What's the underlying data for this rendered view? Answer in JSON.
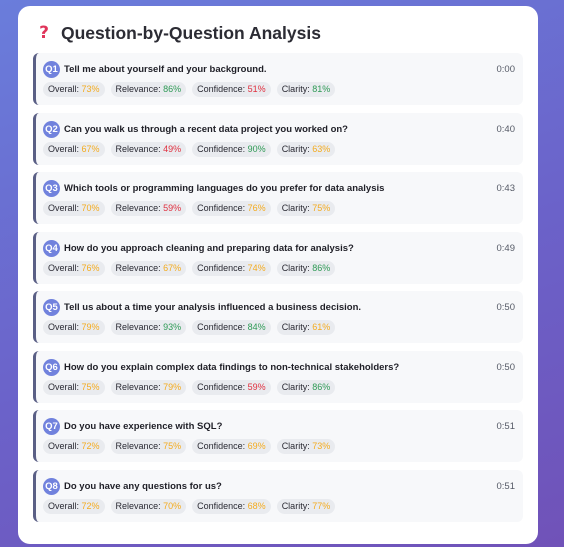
{
  "header": {
    "icon": "question-mark-icon",
    "icon_glyph": "?",
    "title": "Question-by-Question Analysis"
  },
  "colors": {
    "yellow": "#f4ab1e",
    "green": "#2e9a55",
    "red": "#e0303f",
    "badge": "#7182dd"
  },
  "questions": [
    {
      "num": "Q1",
      "text": "Tell me about yourself and your background.",
      "time": "0:00",
      "overall_label": "Overall:",
      "overall": "73%",
      "overall_color": "yellow",
      "relevance_label": "Relevance:",
      "relevance": "86%",
      "relevance_color": "green",
      "confidence_label": "Confidence:",
      "confidence": "51%",
      "confidence_color": "red",
      "clarity_label": "Clarity:",
      "clarity": "81%",
      "clarity_color": "green"
    },
    {
      "num": "Q2",
      "text": "Can you walk us through a recent data project you worked on?",
      "time": "0:40",
      "overall_label": "Overall:",
      "overall": "67%",
      "overall_color": "yellow",
      "relevance_label": "Relevance:",
      "relevance": "49%",
      "relevance_color": "red",
      "confidence_label": "Confidence:",
      "confidence": "90%",
      "confidence_color": "green",
      "clarity_label": "Clarity:",
      "clarity": "63%",
      "clarity_color": "yellow"
    },
    {
      "num": "Q3",
      "text": "Which tools or programming languages do you prefer for data analysis",
      "time": "0:43",
      "overall_label": "Overall:",
      "overall": "70%",
      "overall_color": "yellow",
      "relevance_label": "Relevance:",
      "relevance": "59%",
      "relevance_color": "red",
      "confidence_label": "Confidence:",
      "confidence": "76%",
      "confidence_color": "yellow",
      "clarity_label": "Clarity:",
      "clarity": "75%",
      "clarity_color": "yellow"
    },
    {
      "num": "Q4",
      "text": "How do you approach cleaning and preparing data for analysis?",
      "time": "0:49",
      "overall_label": "Overall:",
      "overall": "76%",
      "overall_color": "yellow",
      "relevance_label": "Relevance:",
      "relevance": "67%",
      "relevance_color": "yellow",
      "confidence_label": "Confidence:",
      "confidence": "74%",
      "confidence_color": "yellow",
      "clarity_label": "Clarity:",
      "clarity": "86%",
      "clarity_color": "green"
    },
    {
      "num": "Q5",
      "text": "Tell us about a time your analysis influenced a business decision.",
      "time": "0:50",
      "overall_label": "Overall:",
      "overall": "79%",
      "overall_color": "yellow",
      "relevance_label": "Relevance:",
      "relevance": "93%",
      "relevance_color": "green",
      "confidence_label": "Confidence:",
      "confidence": "84%",
      "confidence_color": "green",
      "clarity_label": "Clarity:",
      "clarity": "61%",
      "clarity_color": "yellow"
    },
    {
      "num": "Q6",
      "text": "How do you explain complex data findings to non-technical stakeholders?",
      "time": "0:50",
      "overall_label": "Overall:",
      "overall": "75%",
      "overall_color": "yellow",
      "relevance_label": "Relevance:",
      "relevance": "79%",
      "relevance_color": "yellow",
      "confidence_label": "Confidence:",
      "confidence": "59%",
      "confidence_color": "red",
      "clarity_label": "Clarity:",
      "clarity": "86%",
      "clarity_color": "green"
    },
    {
      "num": "Q7",
      "text": "Do you have experience with SQL?",
      "time": "0:51",
      "overall_label": "Overall:",
      "overall": "72%",
      "overall_color": "yellow",
      "relevance_label": "Relevance:",
      "relevance": "75%",
      "relevance_color": "yellow",
      "confidence_label": "Confidence:",
      "confidence": "69%",
      "confidence_color": "yellow",
      "clarity_label": "Clarity:",
      "clarity": "73%",
      "clarity_color": "yellow"
    },
    {
      "num": "Q8",
      "text": "Do you have any questions for us?",
      "time": "0:51",
      "overall_label": "Overall:",
      "overall": "72%",
      "overall_color": "yellow",
      "relevance_label": "Relevance:",
      "relevance": "70%",
      "relevance_color": "yellow",
      "confidence_label": "Confidence:",
      "confidence": "68%",
      "confidence_color": "yellow",
      "clarity_label": "Clarity:",
      "clarity": "77%",
      "clarity_color": "yellow"
    }
  ]
}
